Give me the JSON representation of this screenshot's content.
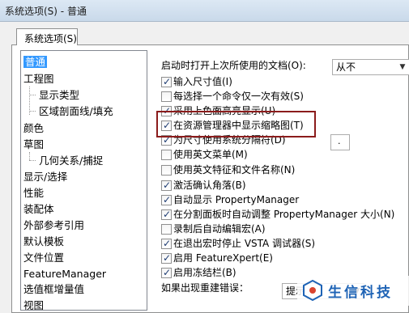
{
  "window": {
    "title": "系统选项(S) - 普通"
  },
  "tab": {
    "label": "系统选项(S)"
  },
  "nav": {
    "items": [
      {
        "label": "普通",
        "selected": true
      },
      {
        "label": "工程图"
      },
      {
        "label": "显示类型"
      },
      {
        "label": "区域剖面线/填充"
      },
      {
        "label": "颜色"
      },
      {
        "label": "草图"
      },
      {
        "label": "几何关系/捕捉"
      },
      {
        "label": "显示/选择"
      },
      {
        "label": "性能"
      },
      {
        "label": "装配体"
      },
      {
        "label": "外部参考引用"
      },
      {
        "label": "默认模板"
      },
      {
        "label": "文件位置"
      },
      {
        "label": "FeatureManager"
      },
      {
        "label": "选值框增量值"
      },
      {
        "label": "视图"
      }
    ]
  },
  "startup": {
    "label": "启动时打开上次所使用的文档(O):",
    "value": "从不"
  },
  "options": [
    {
      "label": "输入尺寸值(I)",
      "checked": true
    },
    {
      "label": "每选择一个命令仅一次有效(S)",
      "checked": false
    },
    {
      "label": "采用上色面高亮显示(U)",
      "checked": true
    },
    {
      "label": "在资源管理器中显示缩略图(T)",
      "checked": true
    },
    {
      "label": "为尺寸使用系统分隔符(D)",
      "checked": true
    },
    {
      "label": "使用英文菜单(M)",
      "checked": false
    },
    {
      "label": "使用英文特征和文件名称(N)",
      "checked": false
    },
    {
      "label": "激活确认角落(B)",
      "checked": true
    },
    {
      "label": "自动显示 PropertyManager",
      "checked": true
    },
    {
      "label": "在分割面板时自动调整 PropertyManager 大小(N)",
      "checked": true
    },
    {
      "label": "录制后自动编辑宏(A)",
      "checked": false
    },
    {
      "label": "在退出宏时停止 VSTA 调试器(S)",
      "checked": true
    },
    {
      "label": "启用 FeatureXpert(E)",
      "checked": true
    },
    {
      "label": "启用冻结栏(B)",
      "checked": true
    }
  ],
  "separator": {
    "value": "."
  },
  "rebuild_error": {
    "label": "如果出现重建错误：",
    "value": "提示"
  },
  "watermark": {
    "text": "生信科技"
  },
  "colors": {
    "selection": "#3399ff",
    "highlight_box": "#8b1c1c",
    "check": "#1f3d73"
  }
}
